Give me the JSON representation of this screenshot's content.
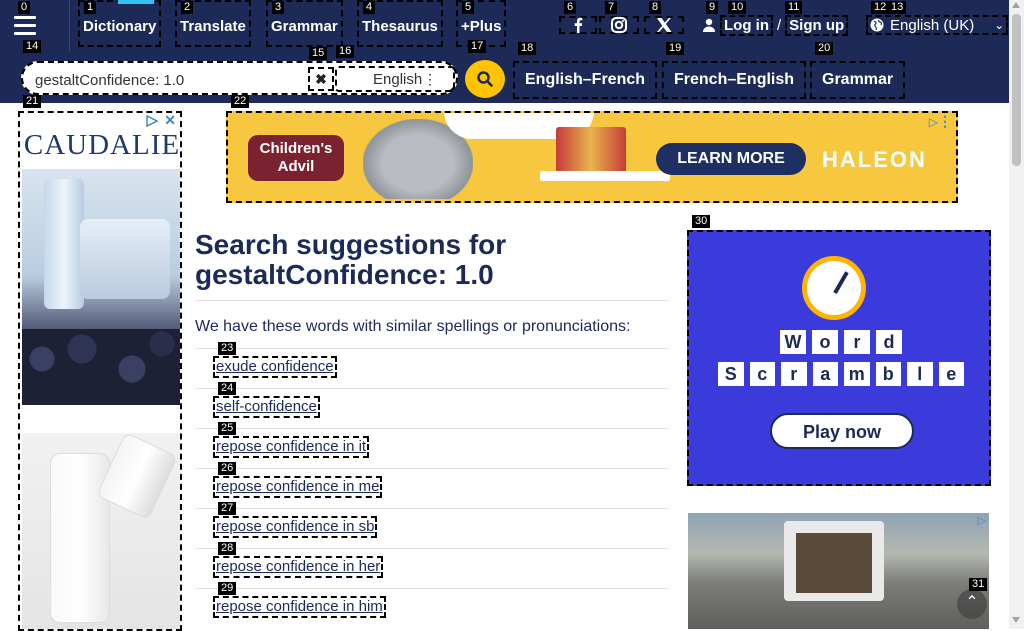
{
  "header": {
    "nav": [
      "Dictionary",
      "Translate",
      "Grammar",
      "Thesaurus",
      "+Plus"
    ],
    "social_icons": [
      "facebook-icon",
      "instagram-icon",
      "x-icon"
    ],
    "login": "Log in",
    "separator": "/",
    "signup": "Sign up",
    "language": "English (UK)"
  },
  "search": {
    "value": "gestaltConfidence: 1.0",
    "clear_icon": "✖",
    "dictionary": "English",
    "subnav": [
      "English–French",
      "French–English",
      "Grammar"
    ]
  },
  "ads": {
    "left_brand": "CAUDALIE",
    "top_brand": "Children's Advil",
    "top_button": "LEARN MORE",
    "top_sponsor": "HALEON",
    "right_title_rows": [
      [
        "W",
        "o",
        "r",
        "d"
      ],
      [
        "S",
        "c",
        "r",
        "a",
        "m",
        "b",
        "l",
        "e"
      ]
    ],
    "right_button": "Play now"
  },
  "main": {
    "title_prefix": "Search suggestions for",
    "title_term": "gestaltConfidence: 1.0",
    "intro": "We have these words with similar spellings or pronunciations:",
    "suggestions": [
      "exude confidence",
      "self-confidence",
      "repose confidence in it",
      "repose confidence in me",
      "repose confidence in sb",
      "repose confidence in her",
      "repose confidence in him"
    ]
  },
  "badges": {
    "b0": "0",
    "b1": "1",
    "b2": "2",
    "b3": "3",
    "b4": "4",
    "b5": "5",
    "b6": "6",
    "b7": "7",
    "b8": "8",
    "b9": "9",
    "b10": "10",
    "b11": "11",
    "b12": "12",
    "b13": "13",
    "b14": "14",
    "b15": "15",
    "b16": "16",
    "b17": "17",
    "b18": "18",
    "b19": "19",
    "b20": "20",
    "b21": "21",
    "b22": "22",
    "b23": "23",
    "b24": "24",
    "b25": "25",
    "b26": "26",
    "b27": "27",
    "b28": "28",
    "b29": "29",
    "b30": "30",
    "b31": "31"
  }
}
